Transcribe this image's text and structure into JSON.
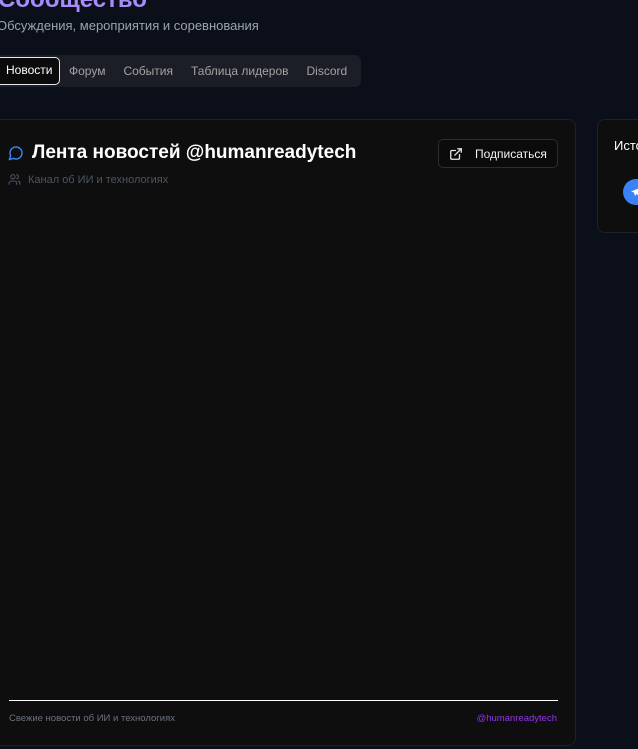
{
  "header": {
    "title": "Сообщество",
    "subtitle": "Обсуждения, мероприятия и соревнования"
  },
  "tabs": [
    {
      "label": "Новости",
      "active": true
    },
    {
      "label": "Форум",
      "active": false
    },
    {
      "label": "События",
      "active": false
    },
    {
      "label": "Таблица лидеров",
      "active": false
    },
    {
      "label": "Discord",
      "active": false
    }
  ],
  "feed": {
    "icon": "message-circle-icon",
    "title": "Лента новостей @humanreadytech",
    "subscribe_label": "Подписаться",
    "subscribe_icon": "external-link-icon",
    "description_icon": "users-icon",
    "description": "Канал об ИИ и технологиях",
    "footer_text": "Свежие новости об ИИ и технологиях",
    "footer_link": "@humanreadytech"
  },
  "sidebar": {
    "title": "Источники",
    "source_icon": "telegram-icon"
  },
  "colors": {
    "background": "#0b0f19",
    "card": "#0e0e0e",
    "accent_title": "#a78bfa",
    "link": "#9333ea",
    "icon_blue": "#3b82f6"
  }
}
